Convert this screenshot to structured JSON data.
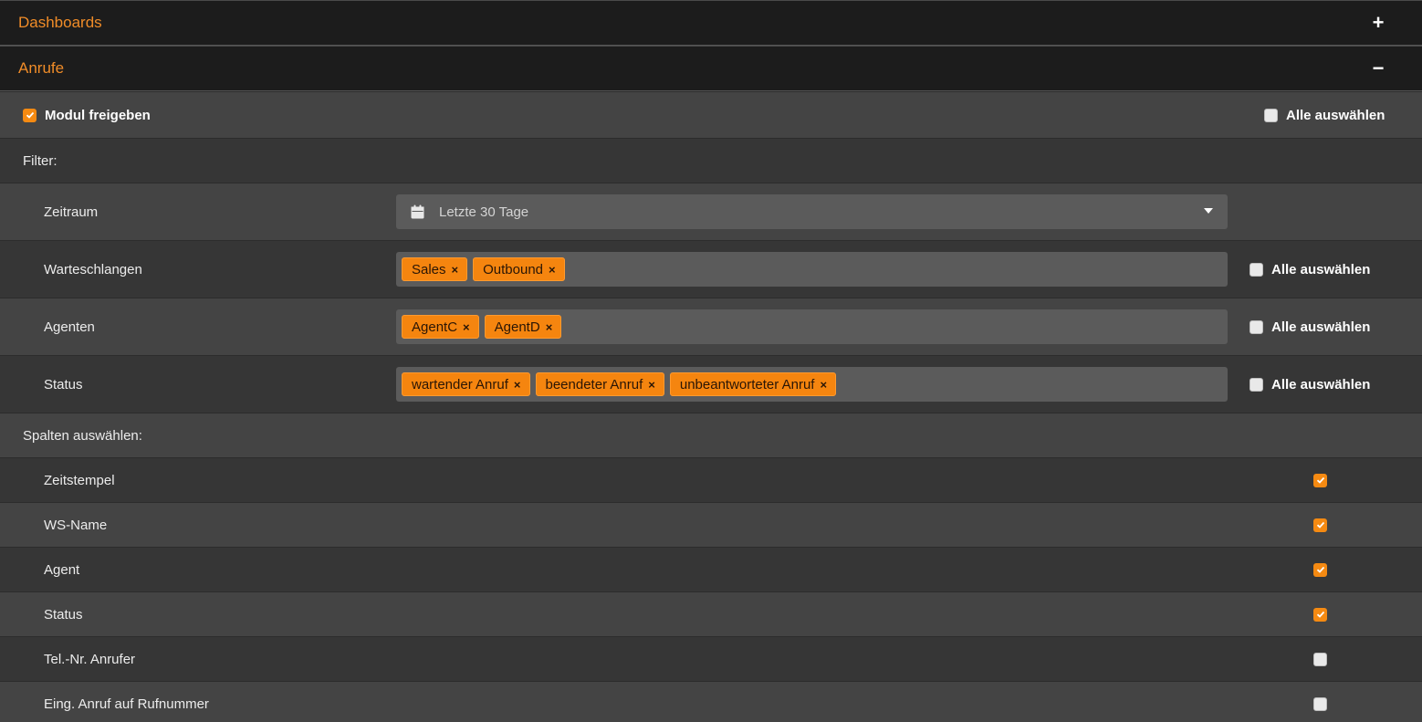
{
  "panels": {
    "dashboards": {
      "title": "Dashboards",
      "toggle": "+"
    },
    "anrufe": {
      "title": "Anrufe",
      "toggle": "−"
    }
  },
  "module": {
    "label": "Modul freigeben",
    "checked": true,
    "select_all_label": "Alle auswählen"
  },
  "filter": {
    "section_label": "Filter:",
    "zeitraum": {
      "label": "Zeitraum",
      "value": "Letzte 30 Tage",
      "icon": "calendar-icon"
    },
    "warteschlangen": {
      "label": "Warteschlangen",
      "chips": [
        "Sales",
        "Outbound"
      ],
      "select_all_label": "Alle auswählen"
    },
    "agenten": {
      "label": "Agenten",
      "chips": [
        "AgentC",
        "AgentD"
      ],
      "select_all_label": "Alle auswählen"
    },
    "status": {
      "label": "Status",
      "chips": [
        "wartender Anruf",
        "beendeter Anruf",
        "unbeantworteter Anruf"
      ],
      "select_all_label": "Alle auswählen"
    },
    "chip_remove_glyph": "×"
  },
  "columns": {
    "section_label": "Spalten auswählen:",
    "items": [
      {
        "label": "Zeitstempel",
        "checked": true
      },
      {
        "label": "WS-Name",
        "checked": true
      },
      {
        "label": "Agent",
        "checked": true
      },
      {
        "label": "Status",
        "checked": true
      },
      {
        "label": "Tel.-Nr. Anrufer",
        "checked": false
      },
      {
        "label": "Eing. Anruf auf Rufnummer",
        "checked": false
      }
    ]
  },
  "colors": {
    "accent": "#f58a12",
    "header_bg": "#1c1c1c",
    "row_light": "#444444",
    "row_dark": "#363636"
  }
}
